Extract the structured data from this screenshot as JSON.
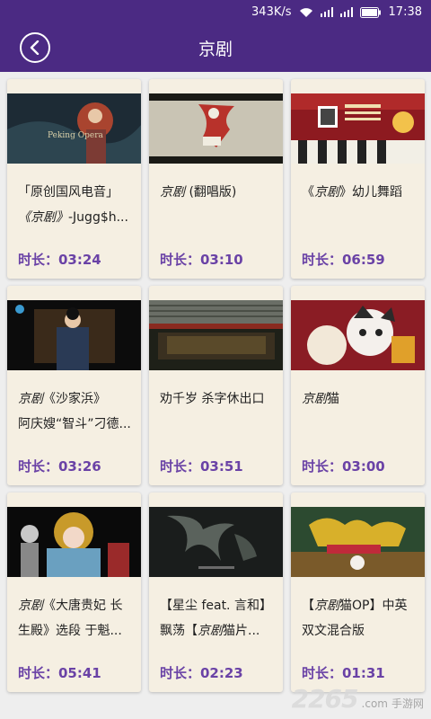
{
  "status_bar": {
    "speed": "343K/s",
    "time": "17:38"
  },
  "header": {
    "title": "京剧"
  },
  "cards": [
    {
      "line1": "「原创国风电音」",
      "line2_em": "《京剧》",
      "line2": "-Jugg$h...",
      "duration": "时长：03:24",
      "thumb_text": "Peking Opera"
    },
    {
      "line1_em": "京剧",
      "line1": " (翻唱版)",
      "duration": "时长：03:10"
    },
    {
      "line1": "《",
      "line1_em": "京剧",
      "line1_tail": "》幼儿舞蹈",
      "duration": "时长：06:59"
    },
    {
      "line1_em": "京剧",
      "line1": "《沙家浜》",
      "line2": "阿庆嫂“智斗”刁德...",
      "duration": "时长：03:26"
    },
    {
      "line1": "劝千岁 杀字休出口",
      "duration": "时长：03:51"
    },
    {
      "line1_em": "京剧",
      "line1": "猫",
      "duration": "时长：03:00"
    },
    {
      "line1_em": "京剧",
      "line1": "《大唐贵妃 长",
      "line2": "生殿》选段 于魁...",
      "duration": "时长：05:41"
    },
    {
      "line1": "【星尘 feat. 言和】",
      "line2": "飘荡【",
      "line2_em": "京剧",
      "line2_tail": "猫片...",
      "duration": "时长：02:23"
    },
    {
      "line1": "【",
      "line1_em": "京剧",
      "line1_tail": "猫OP】中英",
      "line2": "双文混合版",
      "duration": "时长：01:31"
    }
  ],
  "watermark": {
    "number": "2265",
    "suffix": ".com",
    "site": "手游网"
  }
}
